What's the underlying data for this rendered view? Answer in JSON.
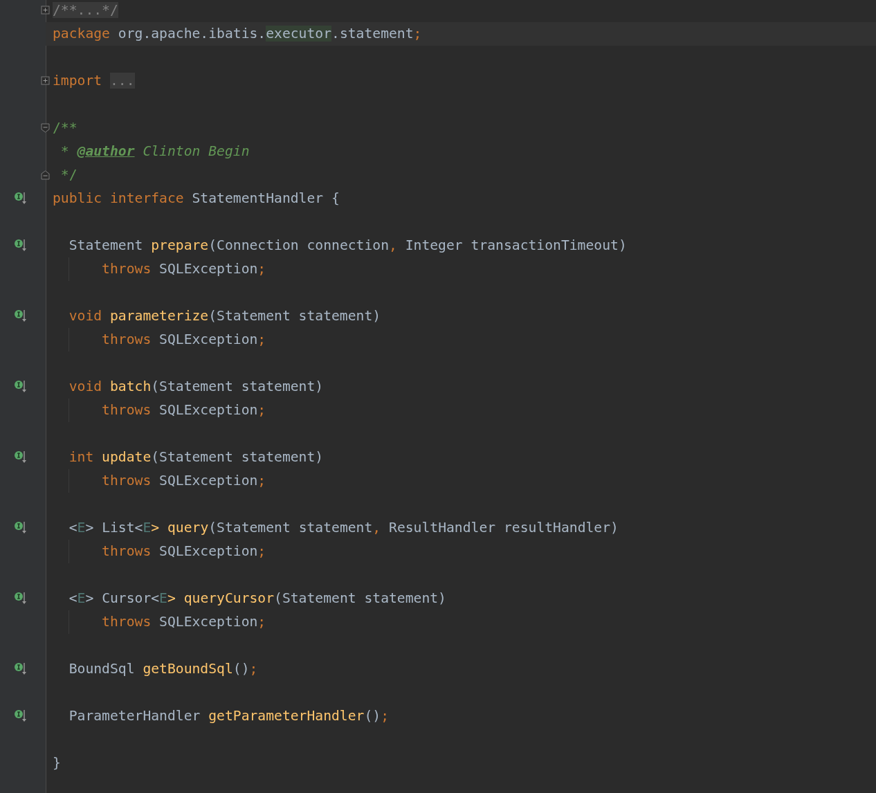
{
  "editor": {
    "lines": [
      {
        "kind": "code",
        "folded": true,
        "tokens": [
          {
            "text": "/**...*/",
            "kind": "folded"
          }
        ]
      },
      {
        "kind": "code",
        "current": true,
        "tokens": [
          {
            "text": "package",
            "kind": "keyword"
          },
          {
            "text": " org.apache.ibatis.",
            "kind": "plain"
          },
          {
            "text": "executor",
            "kind": "match"
          },
          {
            "text": ".statement",
            "kind": "plain"
          },
          {
            "text": ";",
            "kind": "punct"
          }
        ]
      },
      {
        "kind": "blank"
      },
      {
        "kind": "code",
        "folded": true,
        "tokens": [
          {
            "text": "import ",
            "kind": "keyword"
          },
          {
            "text": "...",
            "kind": "folded"
          }
        ]
      },
      {
        "kind": "blank"
      },
      {
        "kind": "code",
        "fold_start": true,
        "tokens": [
          {
            "text": "/**",
            "kind": "doc"
          }
        ]
      },
      {
        "kind": "code",
        "tokens": [
          {
            "text": " * ",
            "kind": "doc"
          },
          {
            "text": "@author",
            "kind": "doc-tag"
          },
          {
            "text": " Clinton Begin",
            "kind": "doc-text"
          }
        ]
      },
      {
        "kind": "code",
        "fold_end": true,
        "tokens": [
          {
            "text": " */",
            "kind": "doc"
          }
        ]
      },
      {
        "kind": "code",
        "implemented": true,
        "tokens": [
          {
            "text": "public interface",
            "kind": "keyword"
          },
          {
            "text": " StatementHandler {",
            "kind": "plain"
          }
        ]
      },
      {
        "kind": "blank"
      },
      {
        "kind": "code",
        "implemented": true,
        "tokens": [
          {
            "text": "  Statement ",
            "kind": "plain"
          },
          {
            "text": "prepare",
            "kind": "method"
          },
          {
            "text": "(Connection connection",
            "kind": "plain"
          },
          {
            "text": ",",
            "kind": "punct"
          },
          {
            "text": " Integer transactionTimeout)",
            "kind": "plain"
          }
        ]
      },
      {
        "kind": "code",
        "indent_guide": true,
        "tokens": [
          {
            "text": "      throws",
            "kind": "keyword"
          },
          {
            "text": " SQLException",
            "kind": "plain"
          },
          {
            "text": ";",
            "kind": "punct"
          }
        ]
      },
      {
        "kind": "blank"
      },
      {
        "kind": "code",
        "implemented": true,
        "tokens": [
          {
            "text": "  void",
            "kind": "keyword"
          },
          {
            "text": " parameterize",
            "kind": "method"
          },
          {
            "text": "(Statement statement)",
            "kind": "plain"
          }
        ]
      },
      {
        "kind": "code",
        "indent_guide": true,
        "tokens": [
          {
            "text": "      throws",
            "kind": "keyword"
          },
          {
            "text": " SQLException",
            "kind": "plain"
          },
          {
            "text": ";",
            "kind": "punct"
          }
        ]
      },
      {
        "kind": "blank"
      },
      {
        "kind": "code",
        "implemented": true,
        "tokens": [
          {
            "text": "  void",
            "kind": "keyword"
          },
          {
            "text": " batch",
            "kind": "method"
          },
          {
            "text": "(Statement statement)",
            "kind": "plain"
          }
        ]
      },
      {
        "kind": "code",
        "indent_guide": true,
        "tokens": [
          {
            "text": "      throws",
            "kind": "keyword"
          },
          {
            "text": " SQLException",
            "kind": "plain"
          },
          {
            "text": ";",
            "kind": "punct"
          }
        ]
      },
      {
        "kind": "blank"
      },
      {
        "kind": "code",
        "implemented": true,
        "tokens": [
          {
            "text": "  int",
            "kind": "keyword"
          },
          {
            "text": " update",
            "kind": "method"
          },
          {
            "text": "(Statement statement)",
            "kind": "plain"
          }
        ]
      },
      {
        "kind": "code",
        "indent_guide": true,
        "tokens": [
          {
            "text": "      throws",
            "kind": "keyword"
          },
          {
            "text": " SQLException",
            "kind": "plain"
          },
          {
            "text": ";",
            "kind": "punct"
          }
        ]
      },
      {
        "kind": "blank"
      },
      {
        "kind": "code",
        "implemented": true,
        "tokens": [
          {
            "text": "  <",
            "kind": "plain"
          },
          {
            "text": "E",
            "kind": "type-param"
          },
          {
            "text": "> List<",
            "kind": "plain"
          },
          {
            "text": "E",
            "kind": "type-param"
          },
          {
            "text": "> query",
            "kind": "method"
          },
          {
            "text": "(Statement statement",
            "kind": "plain"
          },
          {
            "text": ",",
            "kind": "punct"
          },
          {
            "text": " ResultHandler resultHandler)",
            "kind": "plain"
          }
        ]
      },
      {
        "kind": "code",
        "indent_guide": true,
        "tokens": [
          {
            "text": "      throws",
            "kind": "keyword"
          },
          {
            "text": " SQLException",
            "kind": "plain"
          },
          {
            "text": ";",
            "kind": "punct"
          }
        ]
      },
      {
        "kind": "blank"
      },
      {
        "kind": "code",
        "implemented": true,
        "tokens": [
          {
            "text": "  <",
            "kind": "plain"
          },
          {
            "text": "E",
            "kind": "type-param"
          },
          {
            "text": "> Cursor<",
            "kind": "plain"
          },
          {
            "text": "E",
            "kind": "type-param"
          },
          {
            "text": "> queryCursor",
            "kind": "method"
          },
          {
            "text": "(Statement statement)",
            "kind": "plain"
          }
        ]
      },
      {
        "kind": "code",
        "indent_guide": true,
        "tokens": [
          {
            "text": "      throws",
            "kind": "keyword"
          },
          {
            "text": " SQLException",
            "kind": "plain"
          },
          {
            "text": ";",
            "kind": "punct"
          }
        ]
      },
      {
        "kind": "blank"
      },
      {
        "kind": "code",
        "implemented": true,
        "tokens": [
          {
            "text": "  BoundSql ",
            "kind": "plain"
          },
          {
            "text": "getBoundSql",
            "kind": "method"
          },
          {
            "text": "()",
            "kind": "plain"
          },
          {
            "text": ";",
            "kind": "punct"
          }
        ]
      },
      {
        "kind": "blank"
      },
      {
        "kind": "code",
        "implemented": true,
        "tokens": [
          {
            "text": "  ParameterHandler ",
            "kind": "plain"
          },
          {
            "text": "getParameterHandler",
            "kind": "method"
          },
          {
            "text": "()",
            "kind": "plain"
          },
          {
            "text": ";",
            "kind": "punct"
          }
        ]
      },
      {
        "kind": "blank"
      },
      {
        "kind": "code",
        "tokens": [
          {
            "text": "}",
            "kind": "plain"
          }
        ]
      },
      {
        "kind": "blank"
      }
    ]
  }
}
